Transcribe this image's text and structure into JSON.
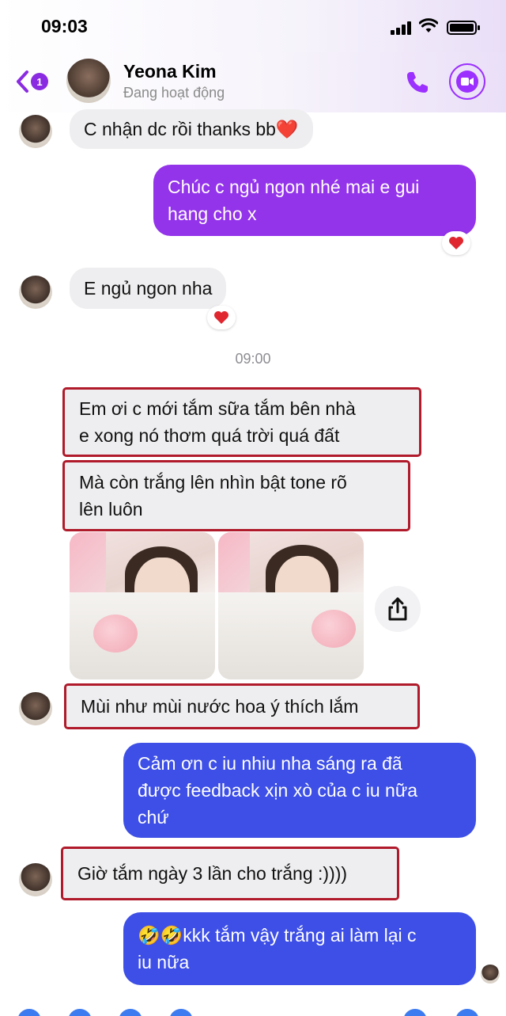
{
  "status_bar": {
    "time": "09:03"
  },
  "header": {
    "back_count": "1",
    "contact_name": "Yeona Kim",
    "contact_status": "Đang hoạt động"
  },
  "colors": {
    "accent_purple": "#9333ea",
    "outgoing_blue": "#3d4fe6",
    "incoming_gray": "#eeeef0",
    "highlight_red": "#b01a2a"
  },
  "messages": [
    {
      "direction": "in",
      "text": "C nhận dc rồi thanks bb❤️"
    },
    {
      "direction": "out",
      "color": "purple",
      "lines": [
        "Chúc c ngủ ngon nhé mai e gui",
        "hang cho x"
      ],
      "reaction": "heart"
    },
    {
      "direction": "in",
      "text": "E ngủ ngon nha",
      "reaction": "heart"
    },
    {
      "type": "timestamp",
      "text": "09:00"
    },
    {
      "direction": "in",
      "highlighted": true,
      "lines": [
        "Em ơi c mới tắm sữa tắm bên nhà",
        "e xong nó thơm quá trời quá đất"
      ]
    },
    {
      "direction": "in",
      "highlighted": true,
      "lines": [
        "Mà còn trắng lên nhìn bật tone rõ",
        "lên luôn"
      ]
    },
    {
      "direction": "in",
      "type": "photos",
      "count": 2
    },
    {
      "direction": "in",
      "highlighted": true,
      "text": "Mùi như mùi nước hoa ý thích lắm"
    },
    {
      "direction": "out",
      "color": "blue",
      "lines": [
        "Cảm ơn c iu nhiu nha sáng ra đã",
        "được  feedback xịn xò của c iu nữa",
        "chứ"
      ]
    },
    {
      "direction": "in",
      "highlighted": true,
      "text": "Giờ tắm ngày 3 lần cho trắng :))))"
    },
    {
      "direction": "out",
      "color": "blue",
      "lines": [
        "🤣🤣kkk tắm vậy trắng ai làm lại c",
        "iu nữa"
      ]
    }
  ]
}
